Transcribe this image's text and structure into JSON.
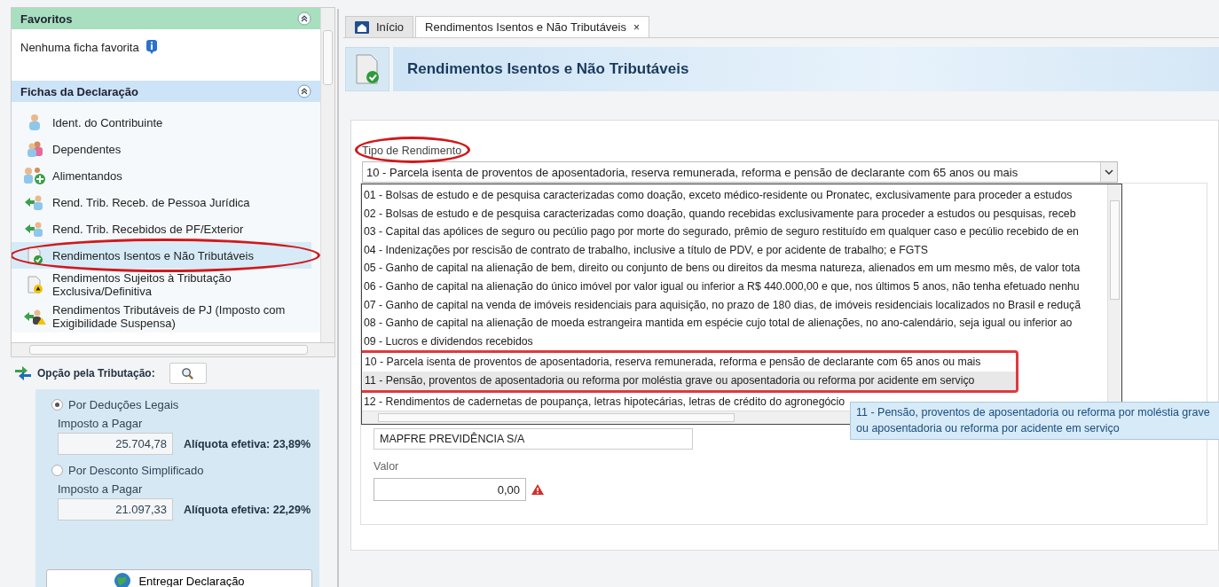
{
  "sidebar": {
    "favorites": {
      "title": "Favoritos",
      "empty_text": "Nenhuma ficha favorita"
    },
    "section": {
      "title": "Fichas da Declaração"
    },
    "items": [
      {
        "label": "Ident. do Contribuinte",
        "kind": "person",
        "selected": false,
        "annotated": false
      },
      {
        "label": "Dependentes",
        "kind": "people",
        "selected": false,
        "annotated": false
      },
      {
        "label": "Alimentandos",
        "kind": "people-add",
        "selected": false,
        "annotated": false
      },
      {
        "label": "Rend. Trib. Receb. de Pessoa Jurídica",
        "kind": "arrow-person",
        "selected": false,
        "annotated": false
      },
      {
        "label": "Rend. Trib. Recebidos de PF/Exterior",
        "kind": "arrow-person",
        "selected": false,
        "annotated": false
      },
      {
        "label": "Rendimentos Isentos e Não Tributáveis",
        "kind": "doc-check",
        "selected": true,
        "annotated": true
      },
      {
        "label": "Rendimentos Sujeitos à Tributação Exclusiva/Definitiva",
        "kind": "doc-warning",
        "selected": false,
        "annotated": false
      },
      {
        "label": "Rendimentos Tributáveis de PJ (Imposto com Exigibilidade Suspensa)",
        "kind": "arrow-warning",
        "selected": false,
        "annotated": false
      }
    ]
  },
  "taxation": {
    "title": "Opção pela Tributação:",
    "options": [
      {
        "label": "Por Deduções Legais",
        "selected": true,
        "amount_label": "Imposto a Pagar",
        "amount": "25.704,78",
        "rate": "Alíquota efetiva: 23,89%"
      },
      {
        "label": "Por Desconto Simplificado",
        "selected": false,
        "amount_label": "Imposto a Pagar",
        "amount": "21.097,33",
        "rate": "Alíquota efetiva: 22,29%"
      }
    ],
    "submit_button": "Entregar Declaração"
  },
  "tabs": [
    {
      "label": "Início",
      "selected": false,
      "closable": false
    },
    {
      "label": "Rendimentos Isentos e Não Tributáveis",
      "selected": true,
      "closable": true,
      "close_glyph": "×"
    }
  ],
  "page_title": "Rendimentos Isentos e Não Tributáveis",
  "form": {
    "type_label": "Tipo de Rendimento",
    "type_label_annotated": true,
    "type_value": "10 - Parcela isenta de proventos de aposentadoria, reserva remunerada, reforma e pensão de declarante com 65 anos ou mais",
    "options": [
      {
        "text": "01 - Bolsas de estudo e de pesquisa caracterizadas como doação, exceto médico-residente ou Pronatec, exclusivamente para proceder a estudos",
        "hovered": false,
        "annotated": false
      },
      {
        "text": "02 - Bolsas de estudo e de pesquisa caracterizadas como doação, quando recebidas exclusivamente para proceder a estudos ou pesquisas, receb",
        "hovered": false,
        "annotated": false
      },
      {
        "text": "03 - Capital das apólices de seguro ou pecúlio pago por morte do segurado, prêmio de seguro restituído em qualquer caso e pecúlio recebido de en",
        "hovered": false,
        "annotated": false
      },
      {
        "text": "04 - Indenizações por rescisão de contrato de trabalho, inclusive a título de PDV, e por acidente de trabalho; e FGTS",
        "hovered": false,
        "annotated": false
      },
      {
        "text": "05 - Ganho de capital na alienação de bem, direito ou conjunto de bens ou direitos da mesma natureza, alienados em um mesmo mês, de valor tota",
        "hovered": false,
        "annotated": false
      },
      {
        "text": "06 - Ganho de capital na alienação do único imóvel por valor igual ou inferior a R$ 440.000,00 e que, nos últimos 5 anos, não tenha efetuado nenhu",
        "hovered": false,
        "annotated": false
      },
      {
        "text": "07 - Ganho de capital na venda de imóveis residenciais para aquisição, no prazo de 180 dias, de imóveis residenciais localizados no Brasil e reduçã",
        "hovered": false,
        "annotated": false
      },
      {
        "text": "08 - Ganho de capital na alienação de moeda estrangeira mantida em espécie cujo total de alienações, no ano-calendário, seja igual ou inferior ao",
        "hovered": false,
        "annotated": false
      },
      {
        "text": "09 - Lucros e dividendos recebidos",
        "hovered": false,
        "annotated": false
      },
      {
        "text": "10 - Parcela isenta de proventos de aposentadoria, reserva remunerada, reforma e pensão de declarante com 65 anos ou mais",
        "hovered": false,
        "annotated": true
      },
      {
        "text": "11 - Pensão, proventos de aposentadoria ou reforma por moléstia grave ou aposentadoria ou reforma por acidente  em serviço",
        "hovered": true,
        "annotated": true
      },
      {
        "text": "12 - Rendimentos de cadernetas de poupança, letras hipotecárias, letras de crédito do agronegócio",
        "hovered": false,
        "annotated": false
      }
    ],
    "tooltip": "11 - Pensão, proventos de aposentadoria ou reforma por moléstia grave ou aposentadoria ou reforma por acidente em serviço",
    "payer": "MAPFRE PREVIDÊNCIA S/A",
    "value_label": "Valor",
    "value": "0,00",
    "value_error": true
  }
}
